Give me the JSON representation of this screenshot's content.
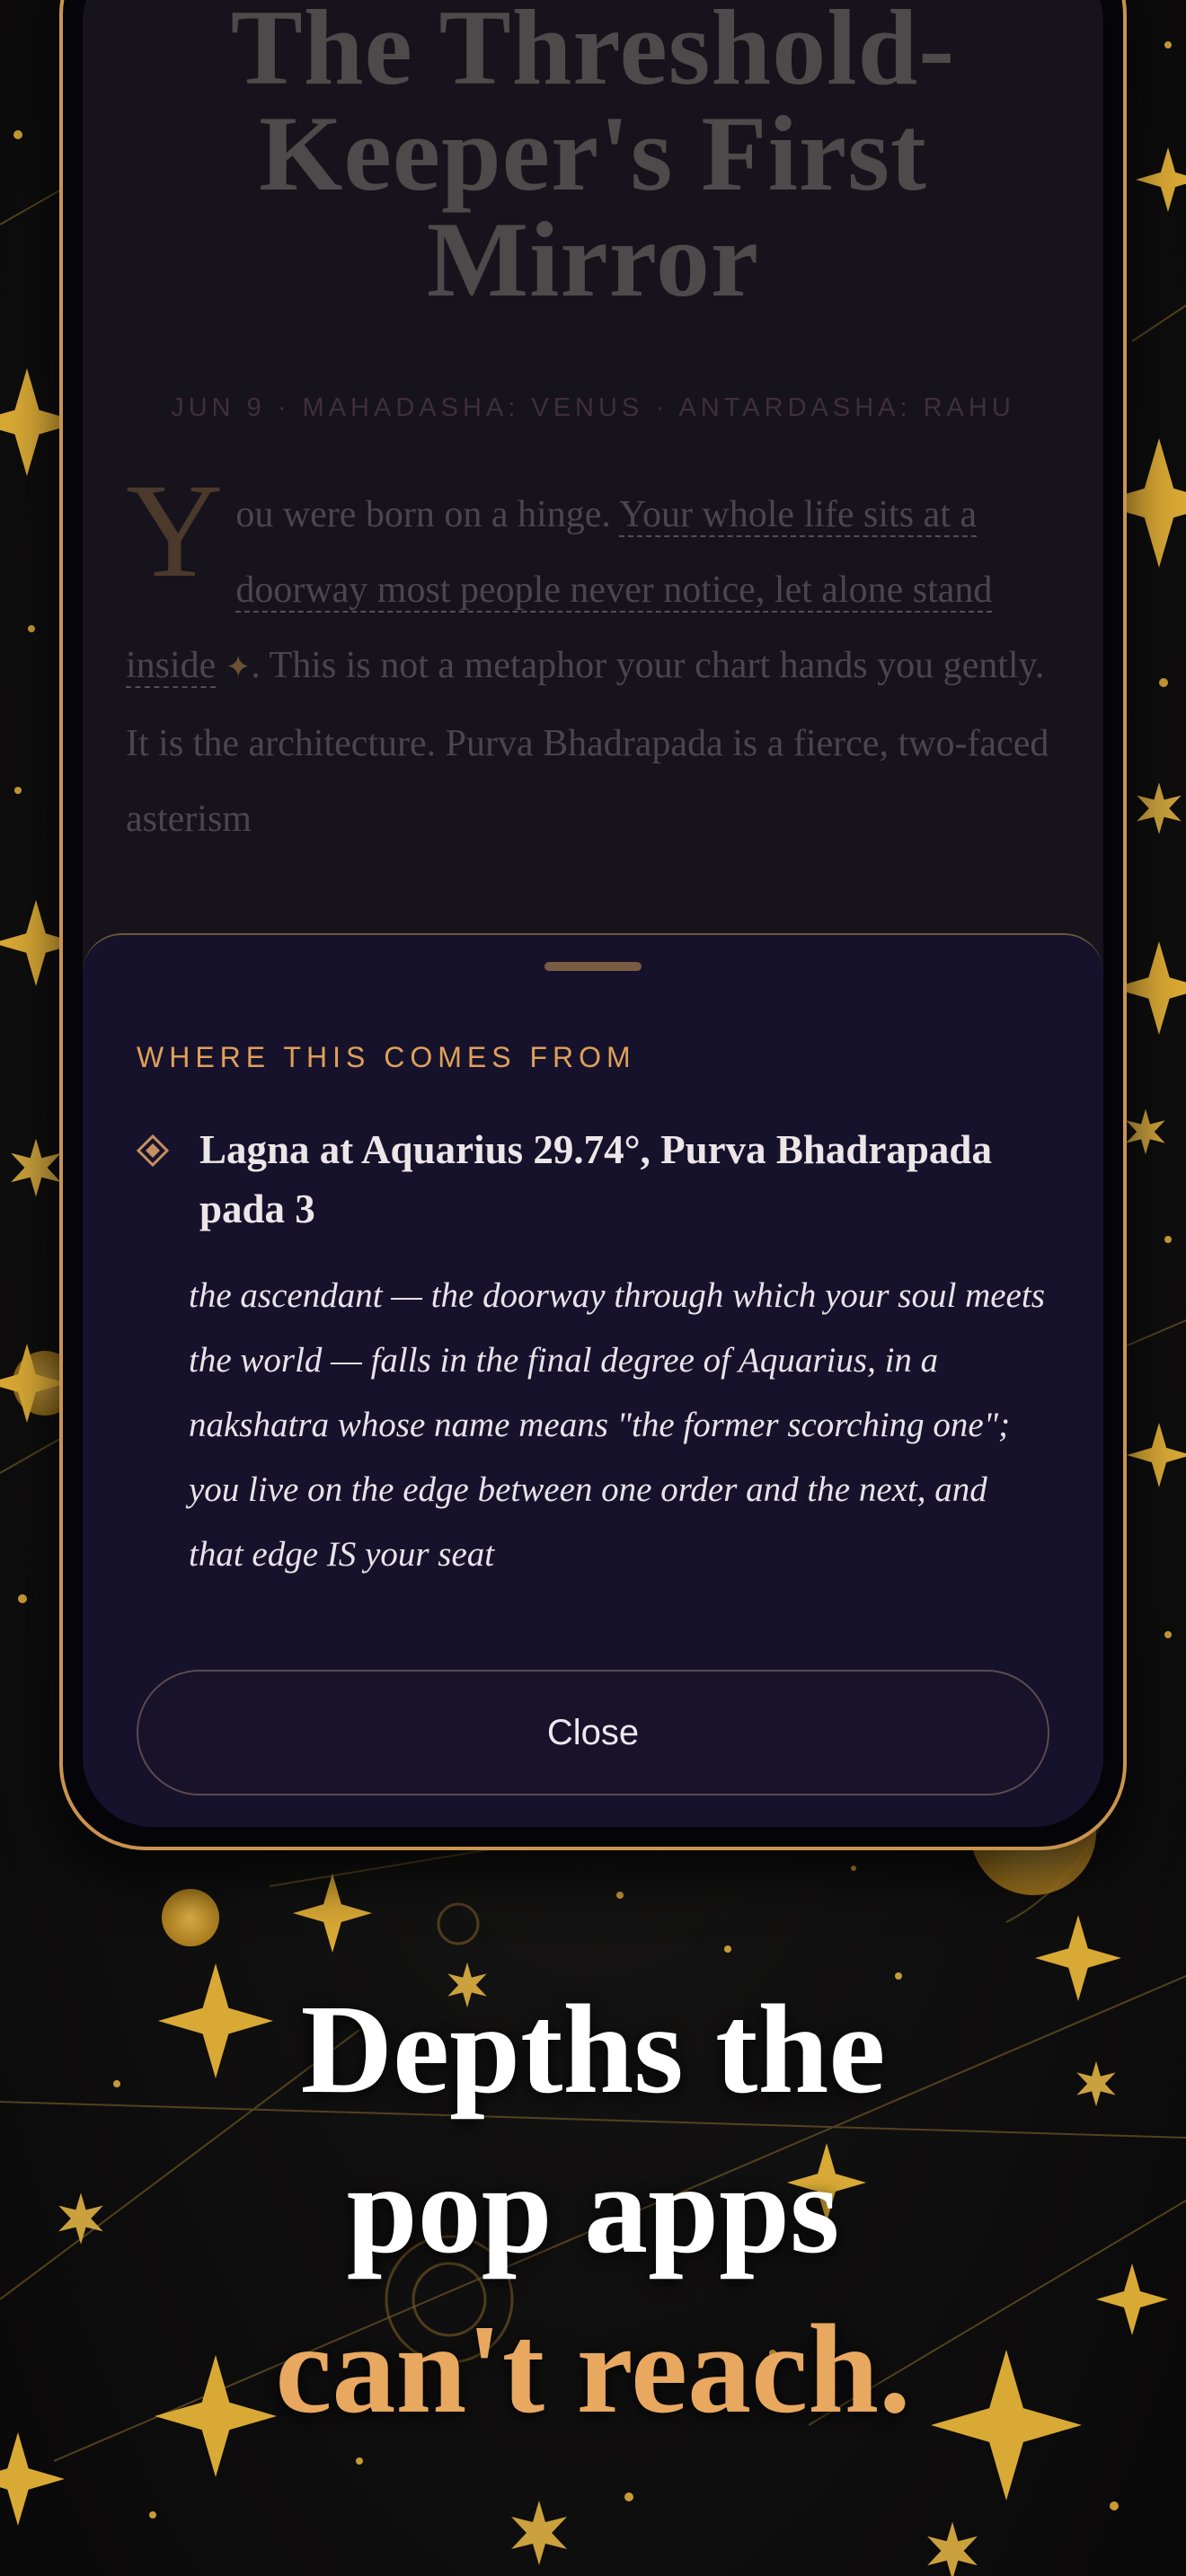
{
  "article": {
    "title": "The Threshold-Keeper's First Mirror",
    "meta": "JUN 9 · MAHADASHA: VENUS · ANTARDASHA: RAHU",
    "dropcap": "Y",
    "text_1": "ou were born on a hinge. ",
    "highlight": "Your whole life sits at a doorway most people never notice, let alone stand inside",
    "text_2": ". This is not a metaphor your chart hands you gently. It is the architecture. Purva Bhadrapada is a fierce, two-faced asterism"
  },
  "sheet": {
    "label": "WHERE THIS COMES FROM",
    "placement": "Lagna at Aquarius 29.74°, Purva Bhadrapada pada 3",
    "explanation": "the ascendant — the doorway through which your soul meets the world — falls in the final degree of Aquarius, in a nakshatra whose name means \"the former scorching one\"; you live on the edge between one order and the next, and that edge IS your seat",
    "close_label": "Close"
  },
  "tagline": {
    "line_1": "Depths the",
    "line_2": "pop apps",
    "line_3": "can't reach."
  },
  "colors": {
    "accent": "#e8a860",
    "frame": "#c9944f",
    "sheet_bg": "#17122b",
    "star_gold": "#d9a935"
  },
  "icons": {
    "bullet": "diamond-icon",
    "inline_marker": "sparkle-icon"
  }
}
